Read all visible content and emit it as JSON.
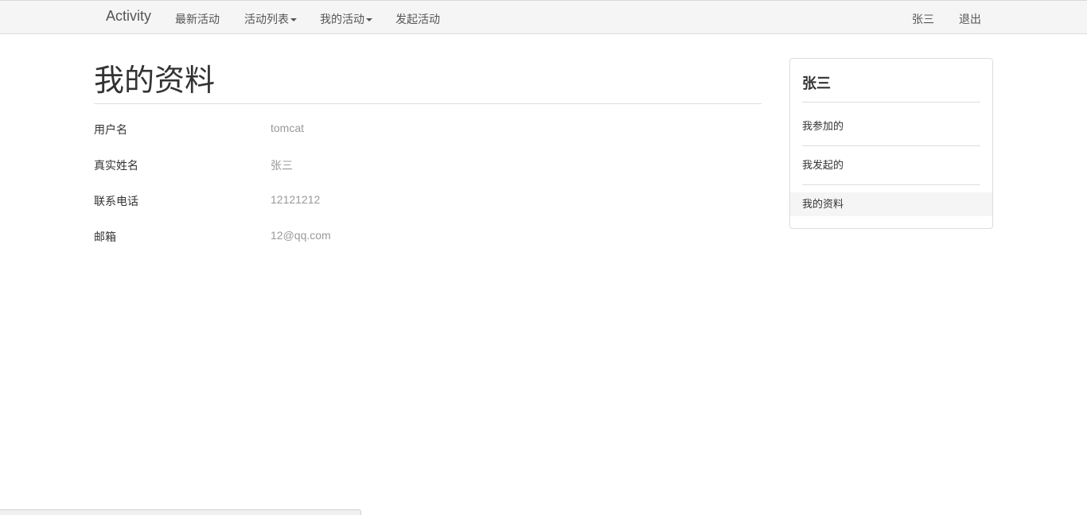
{
  "navbar": {
    "brand": "Activity",
    "items": [
      {
        "label": "最新活动",
        "dropdown": false
      },
      {
        "label": "活动列表",
        "dropdown": true
      },
      {
        "label": "我的活动",
        "dropdown": true
      },
      {
        "label": "发起活动",
        "dropdown": false
      }
    ],
    "user": "张三",
    "logout": "退出"
  },
  "main": {
    "title": "我的资料",
    "fields": [
      {
        "label": "用户名",
        "value": "tomcat"
      },
      {
        "label": "真实姓名",
        "value": "张三"
      },
      {
        "label": "联系电话",
        "value": "12121212"
      },
      {
        "label": "邮箱",
        "value": "12@qq.com"
      }
    ]
  },
  "sidebar": {
    "heading": "张三",
    "items": [
      {
        "label": "我参加的",
        "active": false
      },
      {
        "label": "我发起的",
        "active": false
      },
      {
        "label": "我的资料",
        "active": true
      }
    ]
  },
  "colors": {
    "navbar_bg": "#f5f5f5",
    "text": "#333333",
    "muted_value": "#999999",
    "border": "#dddddd"
  }
}
